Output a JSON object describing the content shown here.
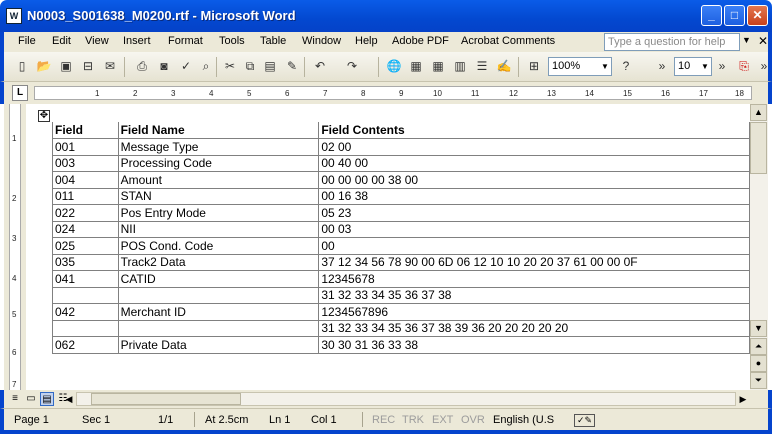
{
  "window": {
    "title": "N0003_S001638_M0200.rtf - Microsoft Word",
    "icon_label": "W"
  },
  "menu": [
    "File",
    "Edit",
    "View",
    "Insert",
    "Format",
    "Tools",
    "Table",
    "Window",
    "Help",
    "Adobe PDF",
    "Acrobat Comments"
  ],
  "ask": {
    "placeholder": "Type a question for help"
  },
  "toolbar": {
    "zoom": "100%",
    "font_size": "10"
  },
  "ruler": {
    "marks": [
      "1",
      "2",
      "3",
      "4",
      "5",
      "6",
      "7",
      "8",
      "9",
      "10",
      "11",
      "12",
      "13",
      "14",
      "15",
      "16",
      "17",
      "18"
    ],
    "vmarks": [
      "1",
      "2",
      "3",
      "4",
      "5",
      "6",
      "7"
    ]
  },
  "table": {
    "headers": [
      "Field",
      "Field Name",
      "Field Contents"
    ],
    "rows": [
      [
        "001",
        "Message Type",
        "02 00"
      ],
      [
        "003",
        "Processing Code",
        "00 40 00"
      ],
      [
        "004",
        "Amount",
        "00 00 00 00 38 00"
      ],
      [
        "011",
        "STAN",
        "00 16 38"
      ],
      [
        "022",
        "Pos Entry Mode",
        "05 23"
      ],
      [
        "024",
        "NII",
        "00 03"
      ],
      [
        "025",
        "POS Cond. Code",
        "00"
      ],
      [
        "035",
        "Track2 Data",
        "37 12 34 56 78 90 00 6D 06 12 10 10 20 20 37 61 00 00 0F"
      ],
      [
        "041",
        "CATID",
        "12345678"
      ],
      [
        "",
        "",
        "31 32 33 34 35 36 37 38"
      ],
      [
        "042",
        "Merchant ID",
        "1234567896"
      ],
      [
        "",
        "",
        "31 32 33 34 35 36 37 38 39 36 20 20 20 20 20"
      ],
      [
        "062",
        "Private Data",
        "30 30 31 36 33 38"
      ]
    ]
  },
  "status": {
    "page": "Page 1",
    "sec": "Sec 1",
    "pages": "1/1",
    "at": "At 2.5cm",
    "ln": "Ln 1",
    "col": "Col 1",
    "rec": "REC",
    "trk": "TRK",
    "ext": "EXT",
    "ovr": "OVR",
    "lang": "English (U.S"
  },
  "colors": {
    "titlebar": "#0a5ce8",
    "chrome": "#ece9d8",
    "frame": "#0544cd"
  }
}
